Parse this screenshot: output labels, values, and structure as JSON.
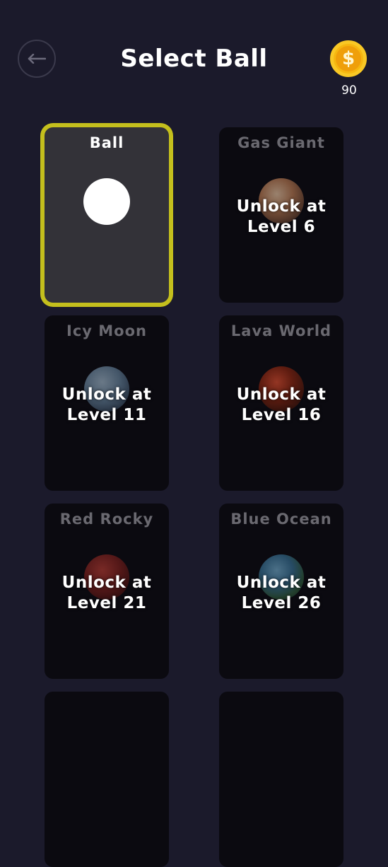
{
  "header": {
    "title": "Select Ball",
    "back_icon": "arrow-left-icon",
    "coin_icon": "coin-dollar-icon",
    "coin_symbol": "$",
    "coin_count": "90"
  },
  "colors": {
    "background": "#1b1a2b",
    "card_locked": "#0b0a10",
    "card_selected": "#333238",
    "selected_border": "#c4bf1d",
    "coin": "#f6b710"
  },
  "balls": [
    {
      "name": "Ball",
      "selected": true,
      "locked": false,
      "lock_text": ""
    },
    {
      "name": "Gas Giant",
      "selected": false,
      "locked": true,
      "lock_text": "Unlock at\nLevel 6"
    },
    {
      "name": "Icy Moon",
      "selected": false,
      "locked": true,
      "lock_text": "Unlock at\nLevel 11"
    },
    {
      "name": "Lava World",
      "selected": false,
      "locked": true,
      "lock_text": "Unlock at\nLevel 16"
    },
    {
      "name": "Red Rocky",
      "selected": false,
      "locked": true,
      "lock_text": "Unlock at\nLevel 21"
    },
    {
      "name": "Blue Ocean",
      "selected": false,
      "locked": true,
      "lock_text": "Unlock at\nLevel 26"
    }
  ]
}
